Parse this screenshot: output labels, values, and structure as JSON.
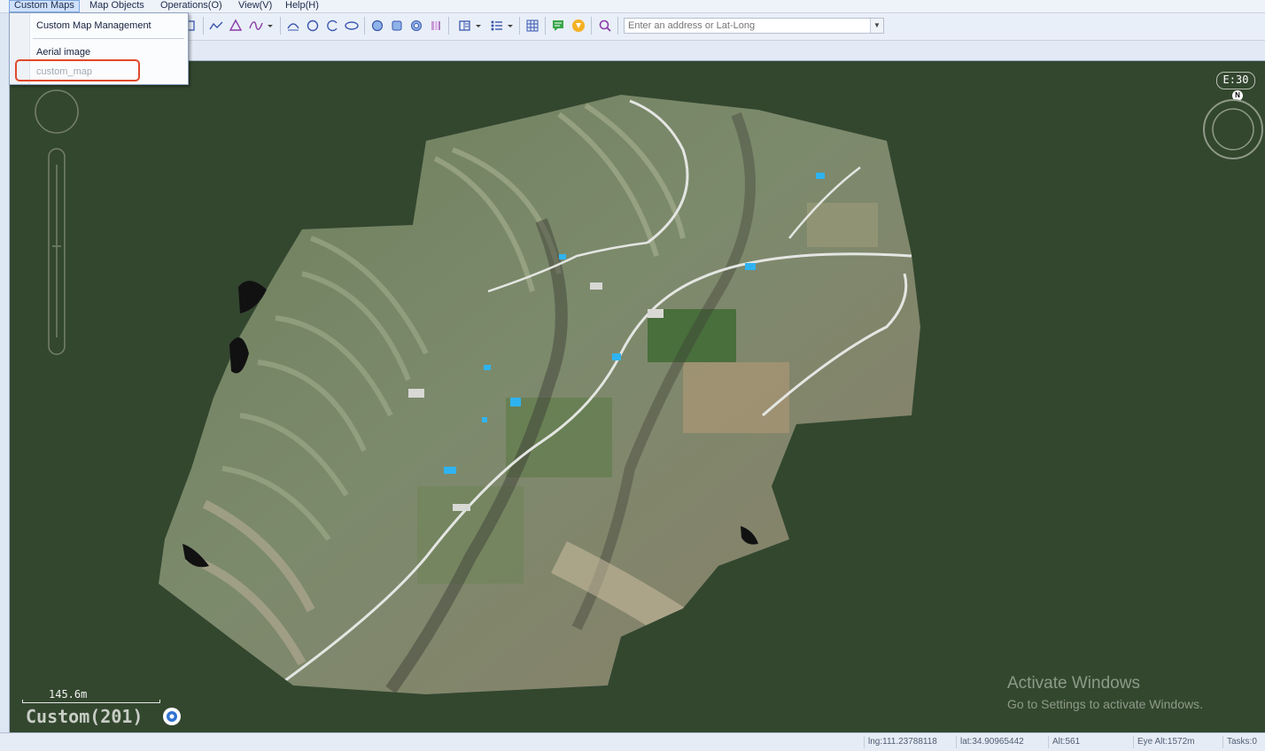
{
  "menubar": {
    "items": [
      "Custom Maps",
      "Map Objects",
      "Operations(O)",
      "View(V)",
      "Help(H)"
    ]
  },
  "dropdown": {
    "items": [
      "Custom Map Management",
      "Aerial image",
      "custom_map"
    ]
  },
  "toolbar": {
    "address_placeholder": "Enter an address or Lat-Long"
  },
  "map": {
    "eye_label": "E:30",
    "north_label": "N",
    "scale_label": "145.6m",
    "source_label": "Custom(201)",
    "watermark_title": "Activate Windows",
    "watermark_subtitle": "Go to Settings to activate Windows."
  },
  "statusbar": {
    "lng": "lng:111.23788118",
    "lat": "lat:34.90965442",
    "alt": "Alt:561",
    "eye_alt": "Eye Alt:1572m",
    "tasks": "Tasks:0"
  },
  "colors": {
    "map_background": "#33472f",
    "highlight_box": "#e0482c",
    "toolbar_icon": "#3a56b0"
  }
}
